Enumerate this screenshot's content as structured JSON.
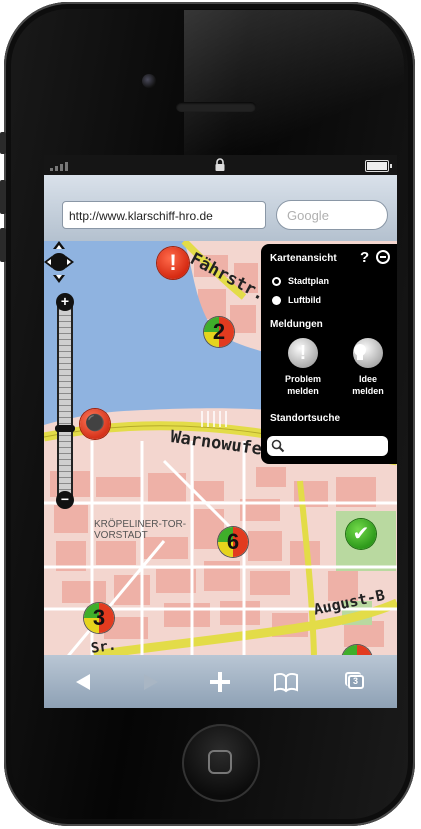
{
  "browser": {
    "url": "http://www.klarschiff-hro.de",
    "search_placeholder": "Google"
  },
  "map": {
    "district_label_line1": "KRÖPELINER-TOR-",
    "district_label_line2": "VORSTADT",
    "streets": [
      "Fährstr.",
      "Warnowufer",
      "August-B",
      "Sr."
    ],
    "markers": [
      {
        "type": "cluster",
        "count": "2"
      },
      {
        "type": "cluster",
        "count": "6"
      },
      {
        "type": "cluster",
        "count": "3"
      }
    ]
  },
  "panel": {
    "title": "Kartenansicht",
    "help": "?",
    "layers": [
      {
        "label": "Stadtplan",
        "selected": true
      },
      {
        "label": "Luftbild",
        "selected": false
      }
    ],
    "reports_title": "Meldungen",
    "report_problem_line1": "Problem",
    "report_problem_line2": "melden",
    "report_idea_line1": "Idee",
    "report_idea_line2": "melden",
    "search_title": "Standortsuche",
    "search_value": ""
  },
  "zoom": {
    "plus": "+",
    "minus": "−",
    "level_fraction": 0.62
  },
  "toolbar": {
    "items": [
      "back-arrow-icon",
      "forward-arrow-icon",
      "add-icon",
      "bookmarks-icon",
      "tabs-icon"
    ],
    "tabs_count": "3"
  },
  "colors": {
    "water": "#8fb3e0",
    "road": "#e3dc48",
    "block": "#f0b3aa",
    "warn": "#d52a12",
    "ok": "#2e9a1b"
  }
}
